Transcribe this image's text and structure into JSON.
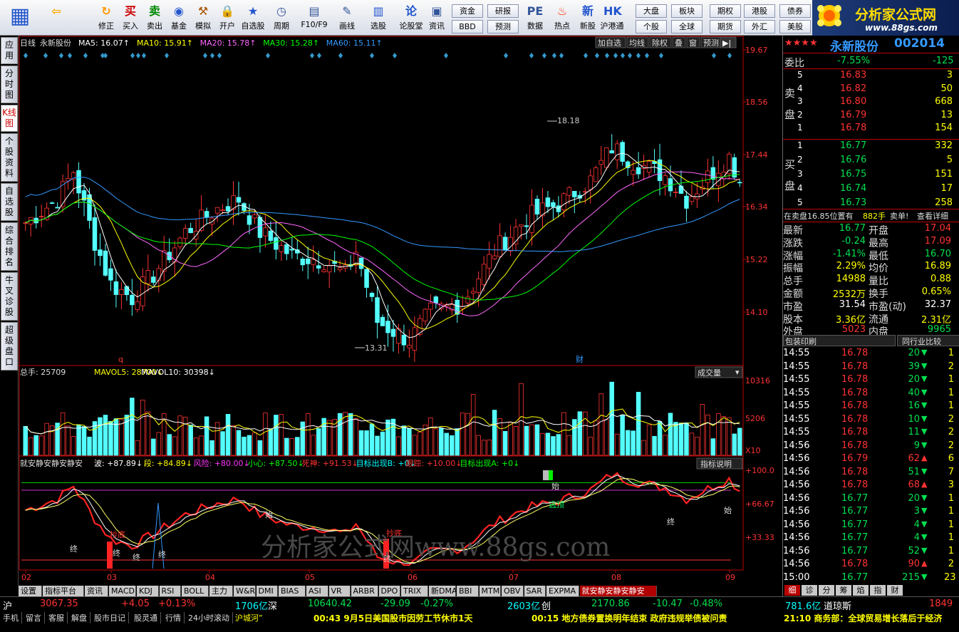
{
  "toolbar": {
    "buttons": [
      {
        "label": "",
        "icon": "windows-icon"
      },
      {
        "label": "",
        "icon": "back-icon"
      },
      {
        "label": "修正",
        "icon": "refresh-icon"
      },
      {
        "label": "买入",
        "icon": "buy-icon"
      },
      {
        "label": "卖出",
        "icon": "sell-icon"
      },
      {
        "label": "基金",
        "icon": "fund-icon"
      },
      {
        "label": "模拟",
        "icon": "hammer-icon"
      },
      {
        "label": "开户",
        "icon": "lock-icon"
      },
      {
        "label": "自选股",
        "icon": "star-icon"
      },
      {
        "label": "周期",
        "icon": "clock-icon"
      },
      {
        "label": "F10/F9",
        "icon": "f10-icon"
      },
      {
        "label": "画线",
        "icon": "pen-icon"
      },
      {
        "label": "选股",
        "icon": "filter-icon"
      },
      {
        "label": "论股堂",
        "icon": "chat-icon"
      },
      {
        "label": "资讯",
        "icon": "news-icon"
      },
      {
        "label": "数据",
        "icon": "pe-icon"
      },
      {
        "label": "热点",
        "icon": "fire-icon"
      },
      {
        "label": "新股",
        "icon": "newstock-icon"
      },
      {
        "label": "沪港通",
        "icon": "hk-icon"
      }
    ],
    "small_buttons": [
      "资金",
      "研报",
      "BBD",
      "预测",
      "大盘",
      "板块",
      "个股",
      "全球",
      "期权",
      "港股",
      "债券",
      "期货",
      "外汇",
      "美股"
    ]
  },
  "logo": {
    "title": "分析家公式网",
    "url": "www.88gs.com"
  },
  "sidebar": {
    "tabs": [
      "应用",
      "分时图",
      "K线图",
      "个股资料",
      "自选股",
      "综合排名",
      "牛叉诊股",
      "超级盘口"
    ]
  },
  "chart": {
    "period": "日线",
    "stock_name": "永新股份",
    "ma": [
      {
        "label": "MA5: 16.07",
        "color": "#ffffff"
      },
      {
        "label": "MA10: 15.91",
        "color": "#ffff00"
      },
      {
        "label": "MA20: 15.78",
        "color": "#ff66ff"
      },
      {
        "label": "MA30: 15.28",
        "color": "#00ff00"
      },
      {
        "label": "MA60: 15.11",
        "color": "#3399ff"
      }
    ],
    "top_buttons": [
      "加自选",
      "均线",
      "除权",
      "叠",
      "窗",
      "预测"
    ],
    "price_ticks": [
      "19.67",
      "18.56",
      "17.44",
      "16.34",
      "15.22",
      "14.10"
    ],
    "high_label": "18.18",
    "low_label": "13.31",
    "markers": [
      "q",
      "财"
    ],
    "vol_title": "总手: 25709",
    "vol_ma5": "MAVOL5: 28700",
    "vol_ma10": "MAVOL10: 30398",
    "vol_button": "成交量",
    "vol_ticks": [
      "10316",
      "5206",
      "X10"
    ],
    "ind_name": "就安静安静安静安",
    "ind_items": [
      {
        "label": "波: +87.89",
        "color": "#ffffff"
      },
      {
        "label": "段: +84.89",
        "color": "#ffff00"
      },
      {
        "label": "风险: +80.00",
        "color": "#ff33ff"
      },
      {
        "label": "小心: +87.50",
        "color": "#00ff00"
      },
      {
        "label": "死神: +91.53",
        "color": "#ff3333"
      },
      {
        "label": "目标出现B: +0",
        "color": "#00ffff"
      },
      {
        "label": "跟踪: +10.00",
        "color": "#ff3333"
      },
      {
        "label": "目标出现A: +0",
        "color": "#00ff00"
      }
    ],
    "ind_button": "指标说明",
    "ind_ticks": [
      "+100.0",
      "+66.67",
      "+33.33"
    ],
    "ind_signals": {
      "buy": "抄底",
      "escape": "逃顶",
      "start": "始",
      "end": "终"
    },
    "months": [
      "02",
      "03",
      "04",
      "05",
      "06",
      "07",
      "08",
      "09"
    ],
    "watermark": "分析家公式网www.88gs.com"
  },
  "bottom_tabs": [
    "设置",
    "指标平台",
    "资讯",
    "MACD",
    "KDJ",
    "RSI",
    "BOLL",
    "主力",
    "W&R",
    "DMI",
    "BIAS",
    "ASI",
    "VR",
    "ARBR",
    "DPO",
    "TRIX",
    "新DMA",
    "BBI",
    "MTM",
    "OBV",
    "SAR",
    "EXPMA",
    "就安静安静安静安"
  ],
  "quote": {
    "stars": "★★★★",
    "name": "永新股份",
    "code": "002014",
    "weibi_label": "委比",
    "weibi": "-7.55%",
    "weicha": "-125",
    "sell_label": "卖盘",
    "buy_label": "买盘",
    "sells": [
      {
        "lv": "5",
        "price": "16.83",
        "vol": "3"
      },
      {
        "lv": "4",
        "price": "16.82",
        "vol": "50"
      },
      {
        "lv": "3",
        "price": "16.80",
        "vol": "668"
      },
      {
        "lv": "2",
        "price": "16.79",
        "vol": "13"
      },
      {
        "lv": "1",
        "price": "16.78",
        "vol": "154"
      }
    ],
    "buys": [
      {
        "lv": "1",
        "price": "16.77",
        "vol": "332"
      },
      {
        "lv": "2",
        "price": "16.76",
        "vol": "5"
      },
      {
        "lv": "3",
        "price": "16.75",
        "vol": "151"
      },
      {
        "lv": "4",
        "price": "16.74",
        "vol": "17"
      },
      {
        "lv": "5",
        "price": "16.73",
        "vol": "258"
      }
    ],
    "notice_a": "在卖盘16.85位置有",
    "notice_b": "882手",
    "notice_c": "卖单!",
    "notice_d": "查看详细",
    "stats": [
      {
        "l1": "最新",
        "v1": "16.77",
        "c1": "grn",
        "l2": "开盘",
        "v2": "17.04",
        "c2": "red"
      },
      {
        "l1": "涨跌",
        "v1": "-0.24",
        "c1": "grn",
        "l2": "最高",
        "v2": "17.09",
        "c2": "red"
      },
      {
        "l1": "涨幅",
        "v1": "-1.41%",
        "c1": "grn",
        "l2": "最低",
        "v2": "16.70",
        "c2": "grn"
      },
      {
        "l1": "振幅",
        "v1": "2.29%",
        "c1": "yel",
        "l2": "均价",
        "v2": "16.89",
        "c2": "yel"
      },
      {
        "l1": "总手",
        "v1": "14988",
        "c1": "yel",
        "l2": "量比",
        "v2": "0.88",
        "c2": "yel"
      },
      {
        "l1": "金额",
        "v1": "2532万",
        "c1": "yel",
        "l2": "换手",
        "v2": "0.65%",
        "c2": "yel"
      },
      {
        "l1": "市盈",
        "v1": "31.54",
        "c1": "wht",
        "l2": "市盈(动)",
        "v2": "32.37",
        "c2": "wht"
      },
      {
        "l1": "股本",
        "v1": "3.36亿",
        "c1": "yel",
        "l2": "流通",
        "v2": "2.31亿",
        "c2": "yel"
      },
      {
        "l1": "外盘",
        "v1": "5023",
        "c1": "red",
        "l2": "内盘",
        "v2": "9965",
        "c2": "grn"
      }
    ],
    "tab_a": "包装印刷",
    "tab_b": "同行业比较",
    "ticks": [
      {
        "t": "14:55",
        "p": "16.78",
        "v": "20",
        "d": "down",
        "n": "1"
      },
      {
        "t": "14:55",
        "p": "16.78",
        "v": "39",
        "d": "down",
        "n": "2"
      },
      {
        "t": "14:55",
        "p": "16.78",
        "v": "20",
        "d": "down",
        "n": "1"
      },
      {
        "t": "14:55",
        "p": "16.78",
        "v": "40",
        "d": "down",
        "n": "1"
      },
      {
        "t": "14:55",
        "p": "16.78",
        "v": "16",
        "d": "down",
        "n": "1"
      },
      {
        "t": "14:55",
        "p": "16.78",
        "v": "10",
        "d": "down",
        "n": "2"
      },
      {
        "t": "14:55",
        "p": "16.78",
        "v": "11",
        "d": "down",
        "n": "2"
      },
      {
        "t": "14:56",
        "p": "16.78",
        "v": "9",
        "d": "down",
        "n": "2"
      },
      {
        "t": "14:56",
        "p": "16.79",
        "v": "62",
        "d": "up",
        "n": "6"
      },
      {
        "t": "14:56",
        "p": "16.78",
        "v": "51",
        "d": "down",
        "n": "7"
      },
      {
        "t": "14:56",
        "p": "16.78",
        "v": "68",
        "d": "up",
        "n": "3"
      },
      {
        "t": "14:56",
        "p": "16.77",
        "v": "20",
        "d": "down",
        "n": "1"
      },
      {
        "t": "14:56",
        "p": "16.77",
        "v": "3",
        "d": "down",
        "n": "1"
      },
      {
        "t": "14:56",
        "p": "16.77",
        "v": "4",
        "d": "down",
        "n": "1"
      },
      {
        "t": "14:56",
        "p": "16.77",
        "v": "4",
        "d": "down",
        "n": "1"
      },
      {
        "t": "14:56",
        "p": "16.77",
        "v": "52",
        "d": "down",
        "n": "1"
      },
      {
        "t": "14:56",
        "p": "16.78",
        "v": "90",
        "d": "up",
        "n": "2"
      },
      {
        "t": "15:00",
        "p": "16.77",
        "v": "215",
        "d": "down",
        "n": "23"
      }
    ],
    "bottom_tabs": [
      "细",
      "诊",
      "分",
      "筹",
      "焰",
      "指",
      "财"
    ]
  },
  "status": {
    "sh_label": "沪",
    "sh_val": "3067.35",
    "sh_chg": "+4.05",
    "sh_pct": "+0.13%",
    "sh_amt": "1706亿",
    "sz_label": "深",
    "sz_val": "10640.42",
    "sz_chg": "-29.09",
    "sz_pct": "-0.27%",
    "sz_amt": "2603亿",
    "cy_label": "创",
    "cy_val": "2170.86",
    "cy_chg": "-10.47",
    "cy_pct": "-0.48%",
    "cy_amt": "781.6亿",
    "dj_label": "道琼斯",
    "dj_val": "1849",
    "links": [
      "手机",
      "留言",
      "客服",
      "解盘",
      "股市日记",
      "股灵通",
      "行情",
      "24小时滚动"
    ],
    "news_tag": "沪城河”",
    "news1": "00:43 9月5日美国股市因劳工节休市1天",
    "news2": "00:15 地方债券置换明年结束 政府违规举债被问责",
    "news3": "21:10 商务部：全球贸易增长落后于经济"
  }
}
